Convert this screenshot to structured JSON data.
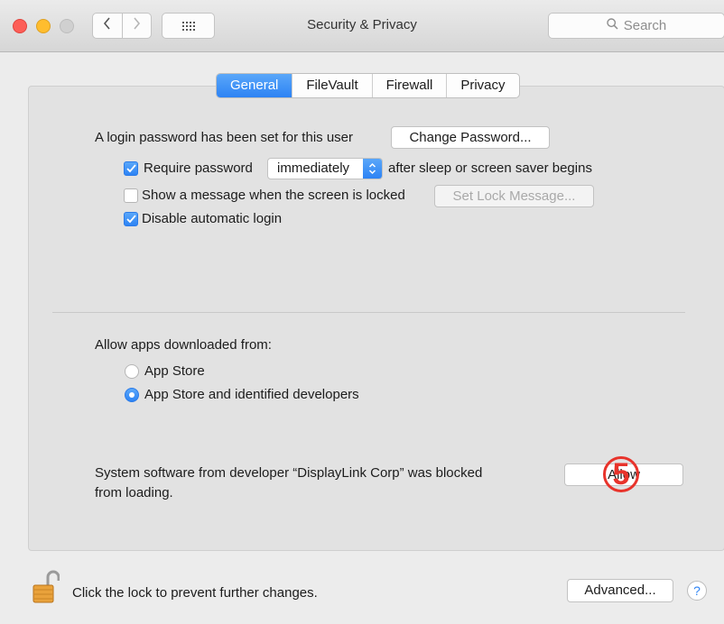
{
  "window": {
    "title": "Security & Privacy",
    "search_placeholder": "Search"
  },
  "tabs": [
    {
      "label": "General",
      "selected": true
    },
    {
      "label": "FileVault",
      "selected": false
    },
    {
      "label": "Firewall",
      "selected": false
    },
    {
      "label": "Privacy",
      "selected": false
    }
  ],
  "general": {
    "login_text": "A login password has been set for this user",
    "change_password_label": "Change Password...",
    "require_password": {
      "label": "Require password",
      "checked": true
    },
    "require_password_value": "immediately",
    "after_sleep_text": "after sleep or screen saver begins",
    "show_message": {
      "label": "Show a message when the screen is locked",
      "checked": false
    },
    "set_lock_message_label": "Set Lock Message...",
    "disable_autologin": {
      "label": "Disable automatic login",
      "checked": true
    }
  },
  "apps": {
    "heading": "Allow apps downloaded from:",
    "options": [
      {
        "label": "App Store",
        "selected": false
      },
      {
        "label": "App Store and identified developers",
        "selected": true
      }
    ]
  },
  "blocked": {
    "line1": "System software from developer “DisplayLink Corp” was blocked",
    "line2": "from loading.",
    "allow_label": "Allow",
    "step_number": "5"
  },
  "footer": {
    "lock_text": "Click the lock to prevent further changes.",
    "advanced_label": "Advanced...",
    "help_label": "?"
  },
  "colors": {
    "accent": "#2d83f4",
    "annotation": "#e8332b"
  }
}
